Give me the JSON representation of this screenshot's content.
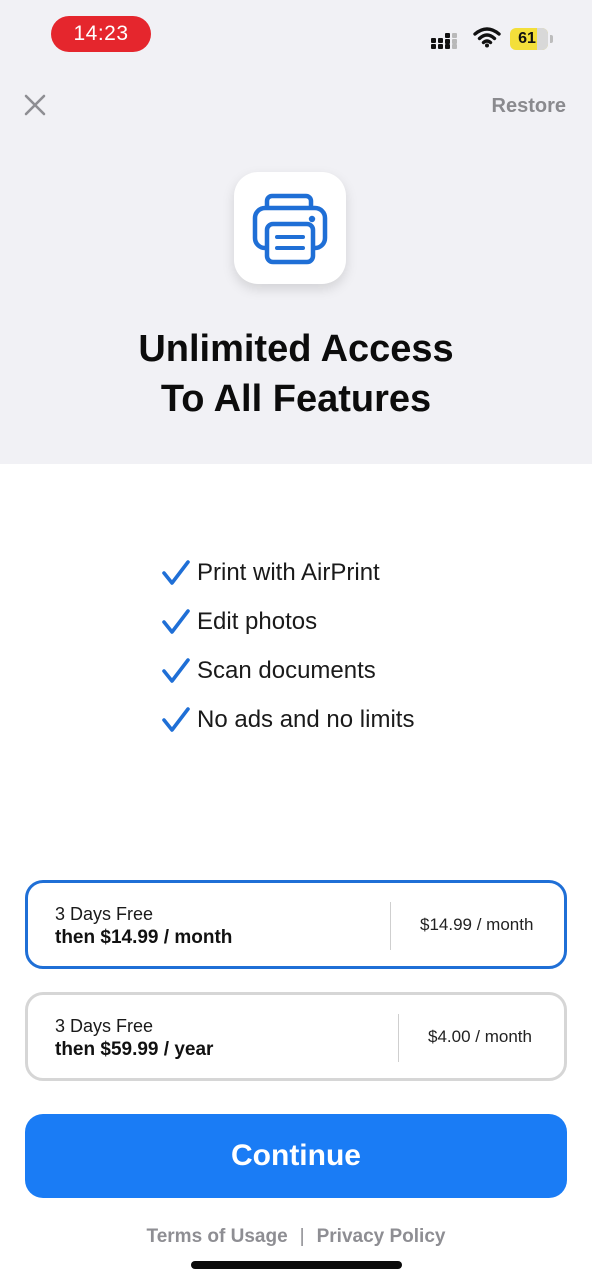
{
  "status_bar": {
    "time": "14:23",
    "battery_level": "61",
    "icons": [
      "signal-icon",
      "wifi-icon",
      "battery-icon"
    ],
    "time_pill_color": "#e5262d",
    "battery_color": "#f3df3a"
  },
  "header": {
    "close_icon": "close-icon",
    "restore_label": "Restore"
  },
  "hero": {
    "app_icon": "printer-icon",
    "headline_line1": "Unlimited Access",
    "headline_line2": "To All Features"
  },
  "features": [
    {
      "icon": "checkmark-icon",
      "label": "Print with AirPrint"
    },
    {
      "icon": "checkmark-icon",
      "label": "Edit photos"
    },
    {
      "icon": "checkmark-icon",
      "label": "Scan documents"
    },
    {
      "icon": "checkmark-icon",
      "label": "No ads and no limits"
    }
  ],
  "plans": [
    {
      "trial": "3 Days Free",
      "price": "then $14.99 / month",
      "monthly": "$14.99 / month",
      "selected": true
    },
    {
      "trial": "3 Days Free",
      "price": "then $59.99 / year",
      "monthly": "$4.00 / month",
      "selected": false
    }
  ],
  "cta": {
    "continue_label": "Continue",
    "color": "#1a7cf5"
  },
  "footer": {
    "terms_label": "Terms of Usage",
    "separator": "|",
    "privacy_label": "Privacy Policy"
  },
  "colors": {
    "accent": "#1f6fd6",
    "top_background": "#f1f1f5"
  }
}
